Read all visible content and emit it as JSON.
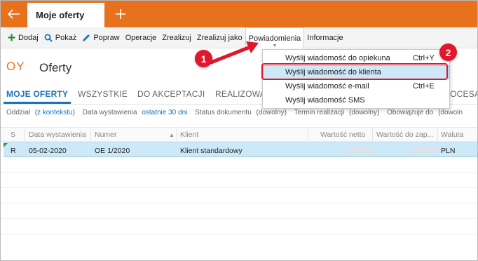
{
  "window": {
    "tab_title": "Moje oferty"
  },
  "toolbar": {
    "items": [
      {
        "label": "Dodaj",
        "icon": "plus-icon"
      },
      {
        "label": "Pokaż",
        "icon": "search-icon"
      },
      {
        "label": "Popraw",
        "icon": "pencil-icon"
      },
      {
        "label": "Operacje"
      },
      {
        "label": "Zrealizuj"
      },
      {
        "label": "Zrealizuj jako"
      },
      {
        "label": "Powiadomienia"
      },
      {
        "label": "Informacje"
      }
    ]
  },
  "header": {
    "module_code": "OY",
    "title": "Oferty"
  },
  "tabs": [
    "MOJE OFERTY",
    "WSZYSTKIE",
    "DO AKCEPTACJI",
    "REALIZOWA",
    "PROCESAL"
  ],
  "filters": [
    {
      "label": "Oddział",
      "value": "(z kontekstu)"
    },
    {
      "label": "Data wystawienia",
      "value": "ostatnie 30 dni"
    },
    {
      "label": "Status dokumentu",
      "value": "(dowolny)"
    },
    {
      "label": "Termin realizacji",
      "value": "(dowolny)"
    },
    {
      "label": "Obowiązuje do",
      "value": "(dowoln"
    }
  ],
  "grid": {
    "columns": [
      "S",
      "Data wystawienia",
      "Numer",
      "Klient",
      "Wartość netto",
      "Wartość do zap...",
      "Waluta"
    ],
    "rows": [
      {
        "status": "R",
        "date": "05-02-2020",
        "number": "OE 1/2020",
        "client": "Klient standardowy",
        "currency": "PLN"
      }
    ]
  },
  "menu": {
    "items": [
      {
        "label": "Wyślij wiadomość do opiekuna",
        "shortcut": "Ctrl+Y"
      },
      {
        "label": "Wyślij wiadomość do klienta",
        "shortcut": ""
      },
      {
        "label": "Wyślij wiadomość e-mail",
        "shortcut": "Ctrl+E"
      },
      {
        "label": "Wyślij wiadomość SMS",
        "shortcut": ""
      }
    ]
  },
  "annotations": {
    "step1": "1",
    "step2": "2",
    "color": "#e1172c"
  },
  "colors": {
    "accent": "#e8711d",
    "link": "#1a73b9",
    "selection": "#cde8f6"
  }
}
